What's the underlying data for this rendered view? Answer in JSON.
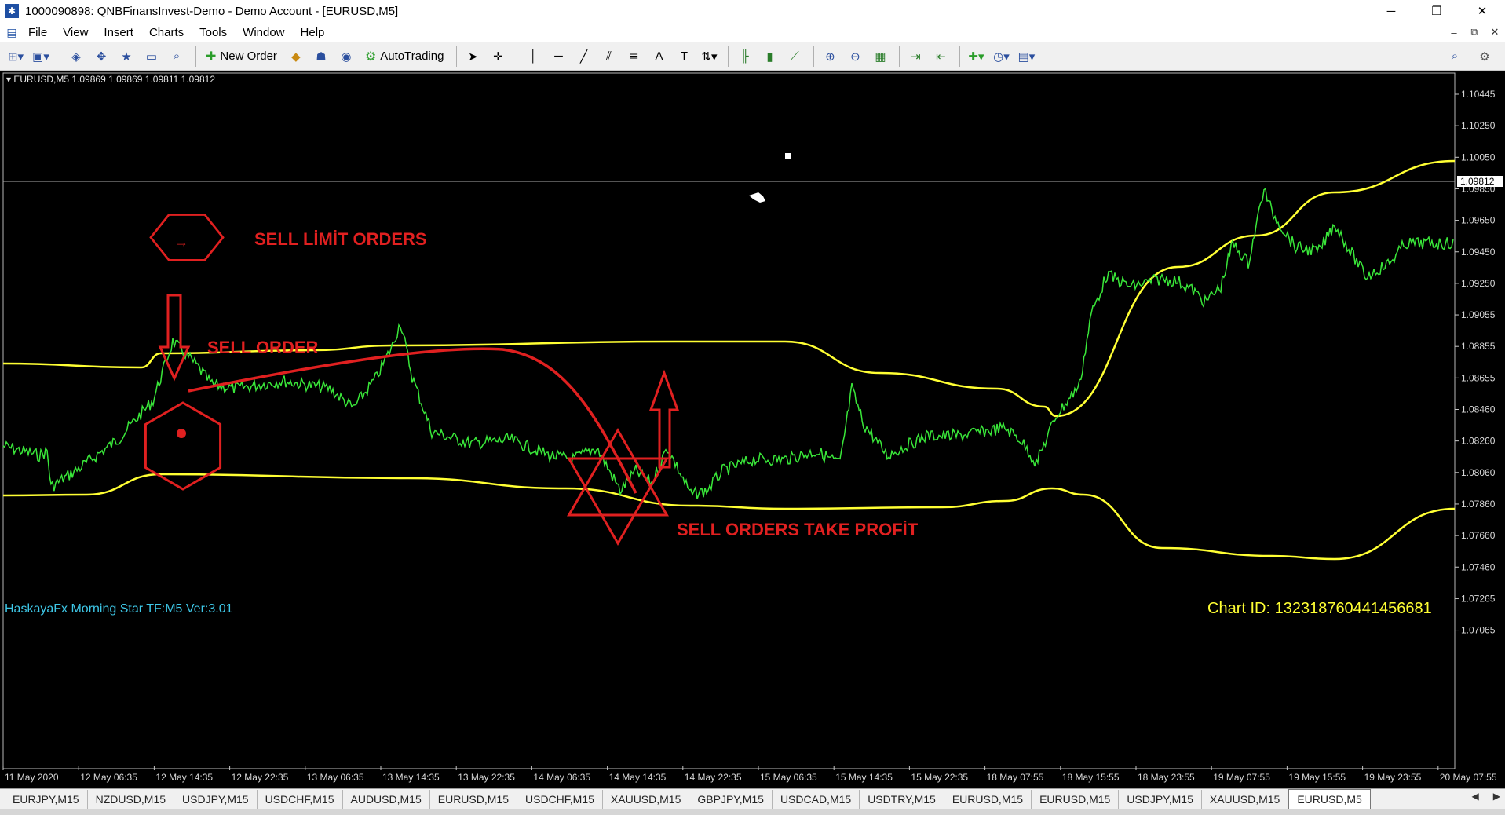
{
  "window": {
    "title": "1000090898: QNBFinansInvest-Demo - Demo Account - [EURUSD,M5]"
  },
  "menu": [
    "File",
    "View",
    "Insert",
    "Charts",
    "Tools",
    "Window",
    "Help"
  ],
  "toolbar": {
    "new_order": "New Order",
    "autotrading": "AutoTrading"
  },
  "chart": {
    "info": "EURUSD,M5  1.09869 1.09869 1.09811 1.09812",
    "price_labels": [
      "1.10445",
      "1.10250",
      "1.10050",
      "1.09850",
      "1.09650",
      "1.09450",
      "1.09250",
      "1.09055",
      "1.08855",
      "1.08655",
      "1.08460",
      "1.08260",
      "1.08060",
      "1.07860",
      "1.07660",
      "1.07460",
      "1.07265",
      "1.07065"
    ],
    "current_price": "1.09812",
    "time_labels": [
      "11 May 2020",
      "12 May 06:35",
      "12 May 14:35",
      "12 May 22:35",
      "13 May 06:35",
      "13 May 14:35",
      "13 May 22:35",
      "14 May 06:35",
      "14 May 14:35",
      "14 May 22:35",
      "15 May 06:35",
      "15 May 14:35",
      "15 May 22:35",
      "18 May 07:55",
      "18 May 15:55",
      "18 May 23:55",
      "19 May 07:55",
      "19 May 15:55",
      "19 May 23:55",
      "20 May 07:55"
    ],
    "indicator_label": "HaskayaFx Morning Star TF:M5 Ver:3.01",
    "chart_id": "Chart ID: 132318760441456681",
    "annotations": {
      "sell_limit": "SELL LİMİT ORDERS",
      "sell_order": "SELL ORDER",
      "take_profit": "SELL ORDERS TAKE PROFİT"
    },
    "colors": {
      "price": "#39e639",
      "band": "#ffff33",
      "annotation": "#e02020",
      "indicator_text": "#3ec8e8",
      "chart_id_text": "#ffff33"
    }
  },
  "tabs": [
    "EURJPY,M15",
    "NZDUSD,M15",
    "USDJPY,M15",
    "USDCHF,M15",
    "AUDUSD,M15",
    "EURUSD,M15",
    "USDCHF,M15",
    "XAUUSD,M15",
    "GBPJPY,M15",
    "USDCAD,M15",
    "USDTRY,M15",
    "EURUSD,M15",
    "EURUSD,M15",
    "USDJPY,M15",
    "XAUUSD,M15",
    "EURUSD,M5"
  ],
  "active_tab": "EURUSD,M5"
}
